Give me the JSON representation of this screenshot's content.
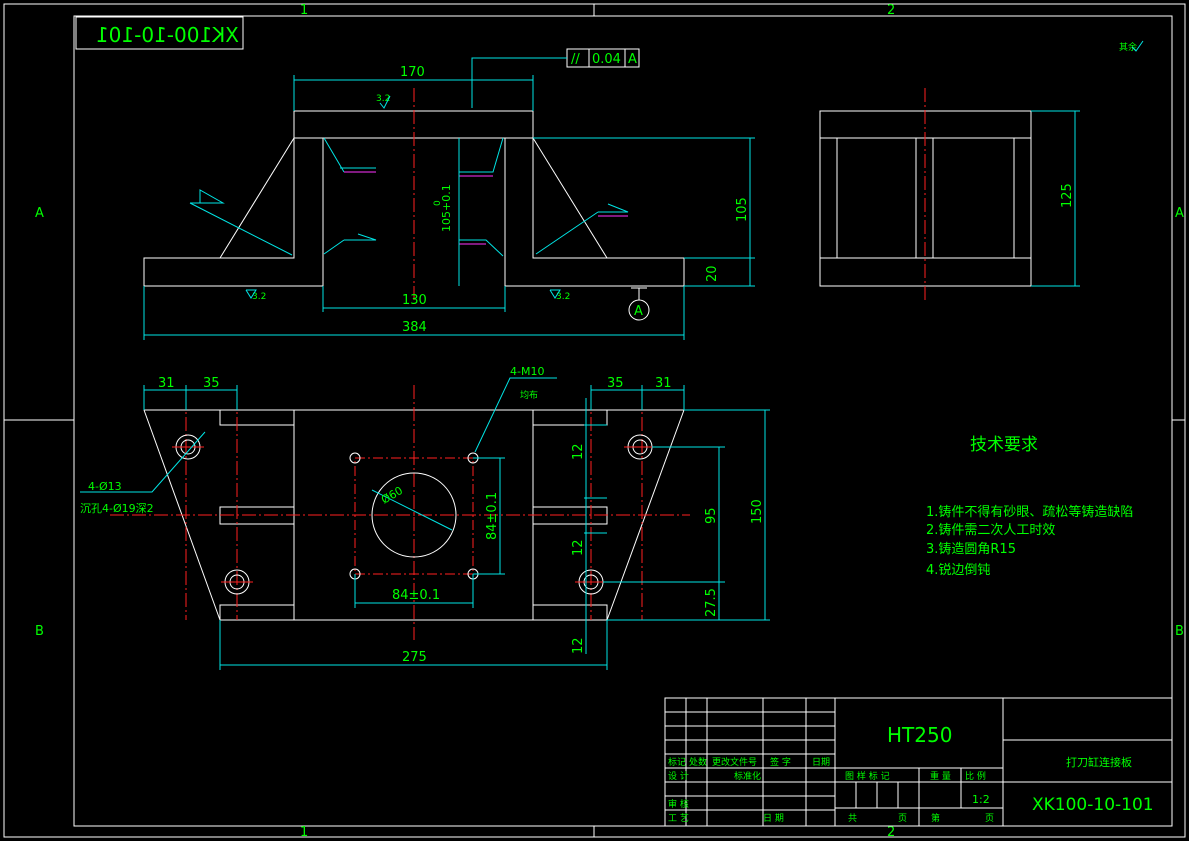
{
  "grid": {
    "col_1": "1",
    "col_2": "2",
    "row_a": "A",
    "row_b": "B"
  },
  "drawing_number_mirrored": "XK100-10-101",
  "roughness_mark": "其余",
  "front_view": {
    "dim_top_width": "170",
    "flatness_symbol": "//",
    "flatness_value": "0.04",
    "flatness_datum": "A",
    "surface_roughness": "3.2",
    "dim_inner_height": "105+0.1",
    "dim_inner_height_sub": "0",
    "dim_height": "105",
    "dim_base_thickness": "20",
    "dim_inner_width": "130",
    "dim_total_width": "384",
    "roughness_left": "3.2",
    "roughness_right": "3.2",
    "datum_label": "A"
  },
  "side_view": {
    "dim_height": "125"
  },
  "top_view": {
    "dim_31_left": "31",
    "dim_35_left": "35",
    "dim_35_right": "35",
    "dim_31_right": "31",
    "thread_holes": "4-M10",
    "thread_note": "均布",
    "hole_callout": "4-Ø13",
    "counterbore_callout": "沉孔4-Ø19深2",
    "bore_dia": "Ø60",
    "dim_84_vertical": "84±0.1",
    "dim_84_horizontal": "84±0.1",
    "dim_12_a": "12",
    "dim_12_b": "12",
    "dim_12_c": "12",
    "dim_95": "95",
    "dim_150": "150",
    "dim_27_5": "27.5",
    "dim_275": "275"
  },
  "tech_req": {
    "title": "技术要求",
    "items": [
      "1.铸件不得有砂眼、疏松等铸造缺陷",
      "2.铸件需二次人工时效",
      "3.铸造圆角R15",
      "4.锐边倒钝"
    ]
  },
  "title_block": {
    "material": "HT250",
    "part_name": "打刀缸连接板",
    "drawing_number": "XK100-10-101",
    "scale": "1:2",
    "labels": {
      "mark": "标记",
      "count": "处数",
      "change_doc": "更改文件号",
      "sign": "签 字",
      "date": "日期",
      "design": "设 计",
      "standard": "标准化",
      "stage": "图 样 标 记",
      "weight": "重 量",
      "ratio": "比 例",
      "check": "审 核",
      "process": "工 艺",
      "approve": "日 期",
      "total": "共",
      "sheet_unit1": "页",
      "nth": "第",
      "sheet_unit2": "页"
    }
  }
}
